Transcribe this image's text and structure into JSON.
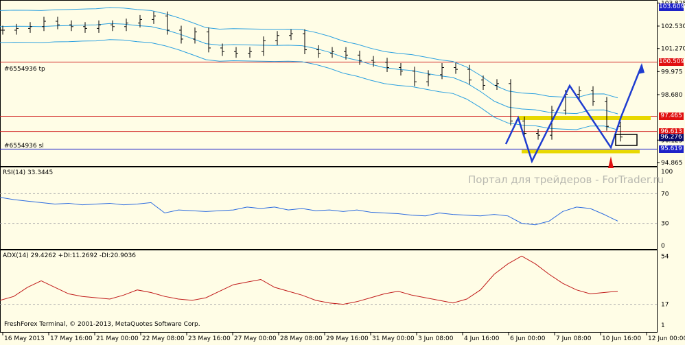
{
  "chart_data": {
    "type": "candlestick",
    "instrument_labels": {
      "tp": "#6554936 tp",
      "sl": "#6554936 sl"
    },
    "price_axis": {
      "ticks": [
        103.825,
        102.53,
        101.27,
        99.975,
        98.68,
        96.125,
        94.865
      ],
      "range": [
        94.865,
        103.825
      ]
    },
    "price_tags": [
      {
        "value": "103.609",
        "color": "#1e22c8"
      },
      {
        "value": "100.509",
        "color": "#e01010"
      },
      {
        "value": "97.465",
        "color": "#e01010"
      },
      {
        "value": "96.613",
        "color": "#e01010"
      },
      {
        "value": "96.276",
        "color": "#0a0a6a"
      },
      {
        "value": "95.619",
        "color": "#1e22c8"
      }
    ],
    "horizontal_lines": [
      100.509,
      97.465,
      96.613,
      95.619
    ],
    "closes": [
      102.3,
      102.4,
      102.5,
      102.8,
      102.6,
      102.5,
      102.4,
      102.6,
      102.5,
      102.7,
      102.9,
      103.1,
      102.3,
      101.8,
      102.2,
      101.3,
      101.1,
      101.0,
      101.1,
      101.7,
      102.0,
      102.1,
      101.2,
      101.0,
      101.1,
      100.9,
      100.6,
      100.5,
      100.2,
      100.0,
      99.4,
      99.8,
      100.2,
      100.1,
      99.5,
      99.2,
      99.3,
      97.2,
      96.5,
      96.4,
      97.8,
      98.7,
      98.9,
      98.3,
      96.9,
      96.3
    ],
    "rsi": {
      "label": "RSI(14) 33.3445",
      "ticks": [
        "100",
        "70",
        "30",
        "0"
      ],
      "values": [
        65,
        62,
        60,
        58,
        56,
        57,
        55,
        56,
        57,
        55,
        56,
        58,
        44,
        48,
        47,
        46,
        47,
        48,
        52,
        50,
        52,
        48,
        50,
        47,
        48,
        46,
        48,
        45,
        44,
        43,
        41,
        40,
        44,
        42,
        41,
        40,
        42,
        40,
        30,
        28,
        33,
        46,
        52,
        50,
        42,
        33
      ]
    },
    "adx": {
      "label": "ADX(14) 29.4262 +DI:11.2692 -DI:20.9036",
      "ticks": [
        "54",
        "17",
        "1"
      ],
      "values": [
        20,
        23,
        30,
        35,
        30,
        25,
        23,
        22,
        21,
        24,
        28,
        26,
        23,
        21,
        20,
        22,
        27,
        32,
        34,
        36,
        30,
        27,
        24,
        20,
        18,
        17,
        19,
        22,
        25,
        27,
        24,
        22,
        20,
        18,
        21,
        28,
        40,
        48,
        54,
        48,
        40,
        33,
        28,
        25,
        26,
        27
      ]
    },
    "x_ticks": [
      "16 May 2013",
      "17 May 16:00",
      "21 May 00:00",
      "22 May 08:00",
      "23 May 16:00",
      "27 May 00:00",
      "28 May 08:00",
      "29 May 16:00",
      "31 May 00:00",
      "3 Jun 08:00",
      "4 Jun 16:00",
      "6 Jun 00:00",
      "7 Jun 08:00",
      "10 Jun 16:00",
      "12 Jun 00:00"
    ],
    "watermark": "Портал для трейдеров - ForTrader.ru",
    "copyright": "FreshForex Terminal, © 2001-2013, MetaQuotes Software Corp."
  }
}
